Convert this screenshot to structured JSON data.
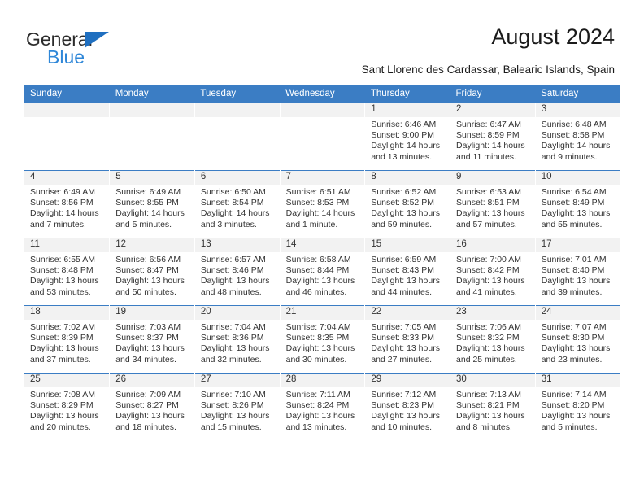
{
  "brand": {
    "name_top": "General",
    "name_bottom": "Blue",
    "accent_color": "#2f87d8",
    "triangle_color": "#1f6fc0"
  },
  "header": {
    "title": "August 2024",
    "subtitle": "Sant Llorenc des Cardassar, Balearic Islands, Spain"
  },
  "calendar": {
    "header_bg": "#3b7dc4",
    "daynum_bg": "#f2f2f2",
    "weekday_headers": [
      "Sunday",
      "Monday",
      "Tuesday",
      "Wednesday",
      "Thursday",
      "Friday",
      "Saturday"
    ],
    "labels": {
      "sunrise": "Sunrise:",
      "sunset": "Sunset:",
      "daylight": "Daylight:"
    },
    "weeks": [
      [
        {
          "day": ""
        },
        {
          "day": ""
        },
        {
          "day": ""
        },
        {
          "day": ""
        },
        {
          "day": "1",
          "sunrise": "Sunrise: 6:46 AM",
          "sunset": "Sunset: 9:00 PM",
          "daylight": "Daylight: 14 hours and 13 minutes."
        },
        {
          "day": "2",
          "sunrise": "Sunrise: 6:47 AM",
          "sunset": "Sunset: 8:59 PM",
          "daylight": "Daylight: 14 hours and 11 minutes."
        },
        {
          "day": "3",
          "sunrise": "Sunrise: 6:48 AM",
          "sunset": "Sunset: 8:58 PM",
          "daylight": "Daylight: 14 hours and 9 minutes."
        }
      ],
      [
        {
          "day": "4",
          "sunrise": "Sunrise: 6:49 AM",
          "sunset": "Sunset: 8:56 PM",
          "daylight": "Daylight: 14 hours and 7 minutes."
        },
        {
          "day": "5",
          "sunrise": "Sunrise: 6:49 AM",
          "sunset": "Sunset: 8:55 PM",
          "daylight": "Daylight: 14 hours and 5 minutes."
        },
        {
          "day": "6",
          "sunrise": "Sunrise: 6:50 AM",
          "sunset": "Sunset: 8:54 PM",
          "daylight": "Daylight: 14 hours and 3 minutes."
        },
        {
          "day": "7",
          "sunrise": "Sunrise: 6:51 AM",
          "sunset": "Sunset: 8:53 PM",
          "daylight": "Daylight: 14 hours and 1 minute."
        },
        {
          "day": "8",
          "sunrise": "Sunrise: 6:52 AM",
          "sunset": "Sunset: 8:52 PM",
          "daylight": "Daylight: 13 hours and 59 minutes."
        },
        {
          "day": "9",
          "sunrise": "Sunrise: 6:53 AM",
          "sunset": "Sunset: 8:51 PM",
          "daylight": "Daylight: 13 hours and 57 minutes."
        },
        {
          "day": "10",
          "sunrise": "Sunrise: 6:54 AM",
          "sunset": "Sunset: 8:49 PM",
          "daylight": "Daylight: 13 hours and 55 minutes."
        }
      ],
      [
        {
          "day": "11",
          "sunrise": "Sunrise: 6:55 AM",
          "sunset": "Sunset: 8:48 PM",
          "daylight": "Daylight: 13 hours and 53 minutes."
        },
        {
          "day": "12",
          "sunrise": "Sunrise: 6:56 AM",
          "sunset": "Sunset: 8:47 PM",
          "daylight": "Daylight: 13 hours and 50 minutes."
        },
        {
          "day": "13",
          "sunrise": "Sunrise: 6:57 AM",
          "sunset": "Sunset: 8:46 PM",
          "daylight": "Daylight: 13 hours and 48 minutes."
        },
        {
          "day": "14",
          "sunrise": "Sunrise: 6:58 AM",
          "sunset": "Sunset: 8:44 PM",
          "daylight": "Daylight: 13 hours and 46 minutes."
        },
        {
          "day": "15",
          "sunrise": "Sunrise: 6:59 AM",
          "sunset": "Sunset: 8:43 PM",
          "daylight": "Daylight: 13 hours and 44 minutes."
        },
        {
          "day": "16",
          "sunrise": "Sunrise: 7:00 AM",
          "sunset": "Sunset: 8:42 PM",
          "daylight": "Daylight: 13 hours and 41 minutes."
        },
        {
          "day": "17",
          "sunrise": "Sunrise: 7:01 AM",
          "sunset": "Sunset: 8:40 PM",
          "daylight": "Daylight: 13 hours and 39 minutes."
        }
      ],
      [
        {
          "day": "18",
          "sunrise": "Sunrise: 7:02 AM",
          "sunset": "Sunset: 8:39 PM",
          "daylight": "Daylight: 13 hours and 37 minutes."
        },
        {
          "day": "19",
          "sunrise": "Sunrise: 7:03 AM",
          "sunset": "Sunset: 8:37 PM",
          "daylight": "Daylight: 13 hours and 34 minutes."
        },
        {
          "day": "20",
          "sunrise": "Sunrise: 7:04 AM",
          "sunset": "Sunset: 8:36 PM",
          "daylight": "Daylight: 13 hours and 32 minutes."
        },
        {
          "day": "21",
          "sunrise": "Sunrise: 7:04 AM",
          "sunset": "Sunset: 8:35 PM",
          "daylight": "Daylight: 13 hours and 30 minutes."
        },
        {
          "day": "22",
          "sunrise": "Sunrise: 7:05 AM",
          "sunset": "Sunset: 8:33 PM",
          "daylight": "Daylight: 13 hours and 27 minutes."
        },
        {
          "day": "23",
          "sunrise": "Sunrise: 7:06 AM",
          "sunset": "Sunset: 8:32 PM",
          "daylight": "Daylight: 13 hours and 25 minutes."
        },
        {
          "day": "24",
          "sunrise": "Sunrise: 7:07 AM",
          "sunset": "Sunset: 8:30 PM",
          "daylight": "Daylight: 13 hours and 23 minutes."
        }
      ],
      [
        {
          "day": "25",
          "sunrise": "Sunrise: 7:08 AM",
          "sunset": "Sunset: 8:29 PM",
          "daylight": "Daylight: 13 hours and 20 minutes."
        },
        {
          "day": "26",
          "sunrise": "Sunrise: 7:09 AM",
          "sunset": "Sunset: 8:27 PM",
          "daylight": "Daylight: 13 hours and 18 minutes."
        },
        {
          "day": "27",
          "sunrise": "Sunrise: 7:10 AM",
          "sunset": "Sunset: 8:26 PM",
          "daylight": "Daylight: 13 hours and 15 minutes."
        },
        {
          "day": "28",
          "sunrise": "Sunrise: 7:11 AM",
          "sunset": "Sunset: 8:24 PM",
          "daylight": "Daylight: 13 hours and 13 minutes."
        },
        {
          "day": "29",
          "sunrise": "Sunrise: 7:12 AM",
          "sunset": "Sunset: 8:23 PM",
          "daylight": "Daylight: 13 hours and 10 minutes."
        },
        {
          "day": "30",
          "sunrise": "Sunrise: 7:13 AM",
          "sunset": "Sunset: 8:21 PM",
          "daylight": "Daylight: 13 hours and 8 minutes."
        },
        {
          "day": "31",
          "sunrise": "Sunrise: 7:14 AM",
          "sunset": "Sunset: 8:20 PM",
          "daylight": "Daylight: 13 hours and 5 minutes."
        }
      ]
    ]
  }
}
